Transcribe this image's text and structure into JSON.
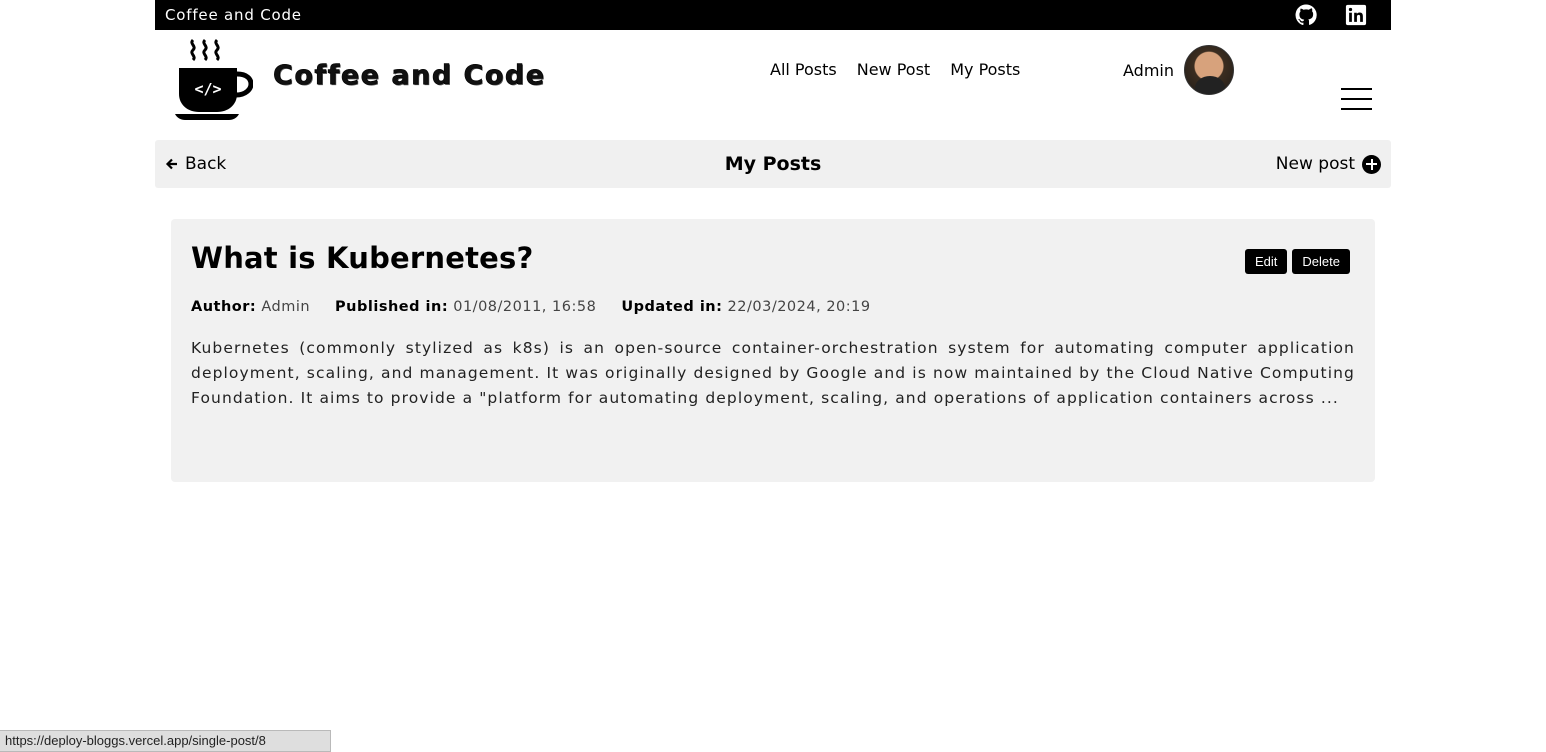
{
  "topbar": {
    "brand": "Coffee and Code",
    "icons": [
      "github-icon",
      "linkedin-icon"
    ]
  },
  "header": {
    "logo_text": "Coffee and Code",
    "nav": [
      "All Posts",
      "New Post",
      "My Posts"
    ],
    "user_name": "Admin"
  },
  "subbar": {
    "back": "Back",
    "title": "My Posts",
    "new_post": "New post"
  },
  "post": {
    "title": "What is Kubernetes?",
    "edit": "Edit",
    "delete": "Delete",
    "author_label": "Author:",
    "author": "Admin",
    "published_label": "Published in:",
    "published": "01/08/2011, 16:58",
    "updated_label": "Updated in:",
    "updated": "22/03/2024, 20:19",
    "excerpt": "Kubernetes (commonly stylized as k8s) is an open-source container-orchestration system for automating computer application deployment, scaling, and management. It was originally designed by Google and is now maintained by the Cloud Native Computing Foundation. It aims to provide a \"platform for automating deployment, scaling, and operations of application containers across ..."
  },
  "status_url": "https://deploy-bloggs.vercel.app/single-post/8"
}
